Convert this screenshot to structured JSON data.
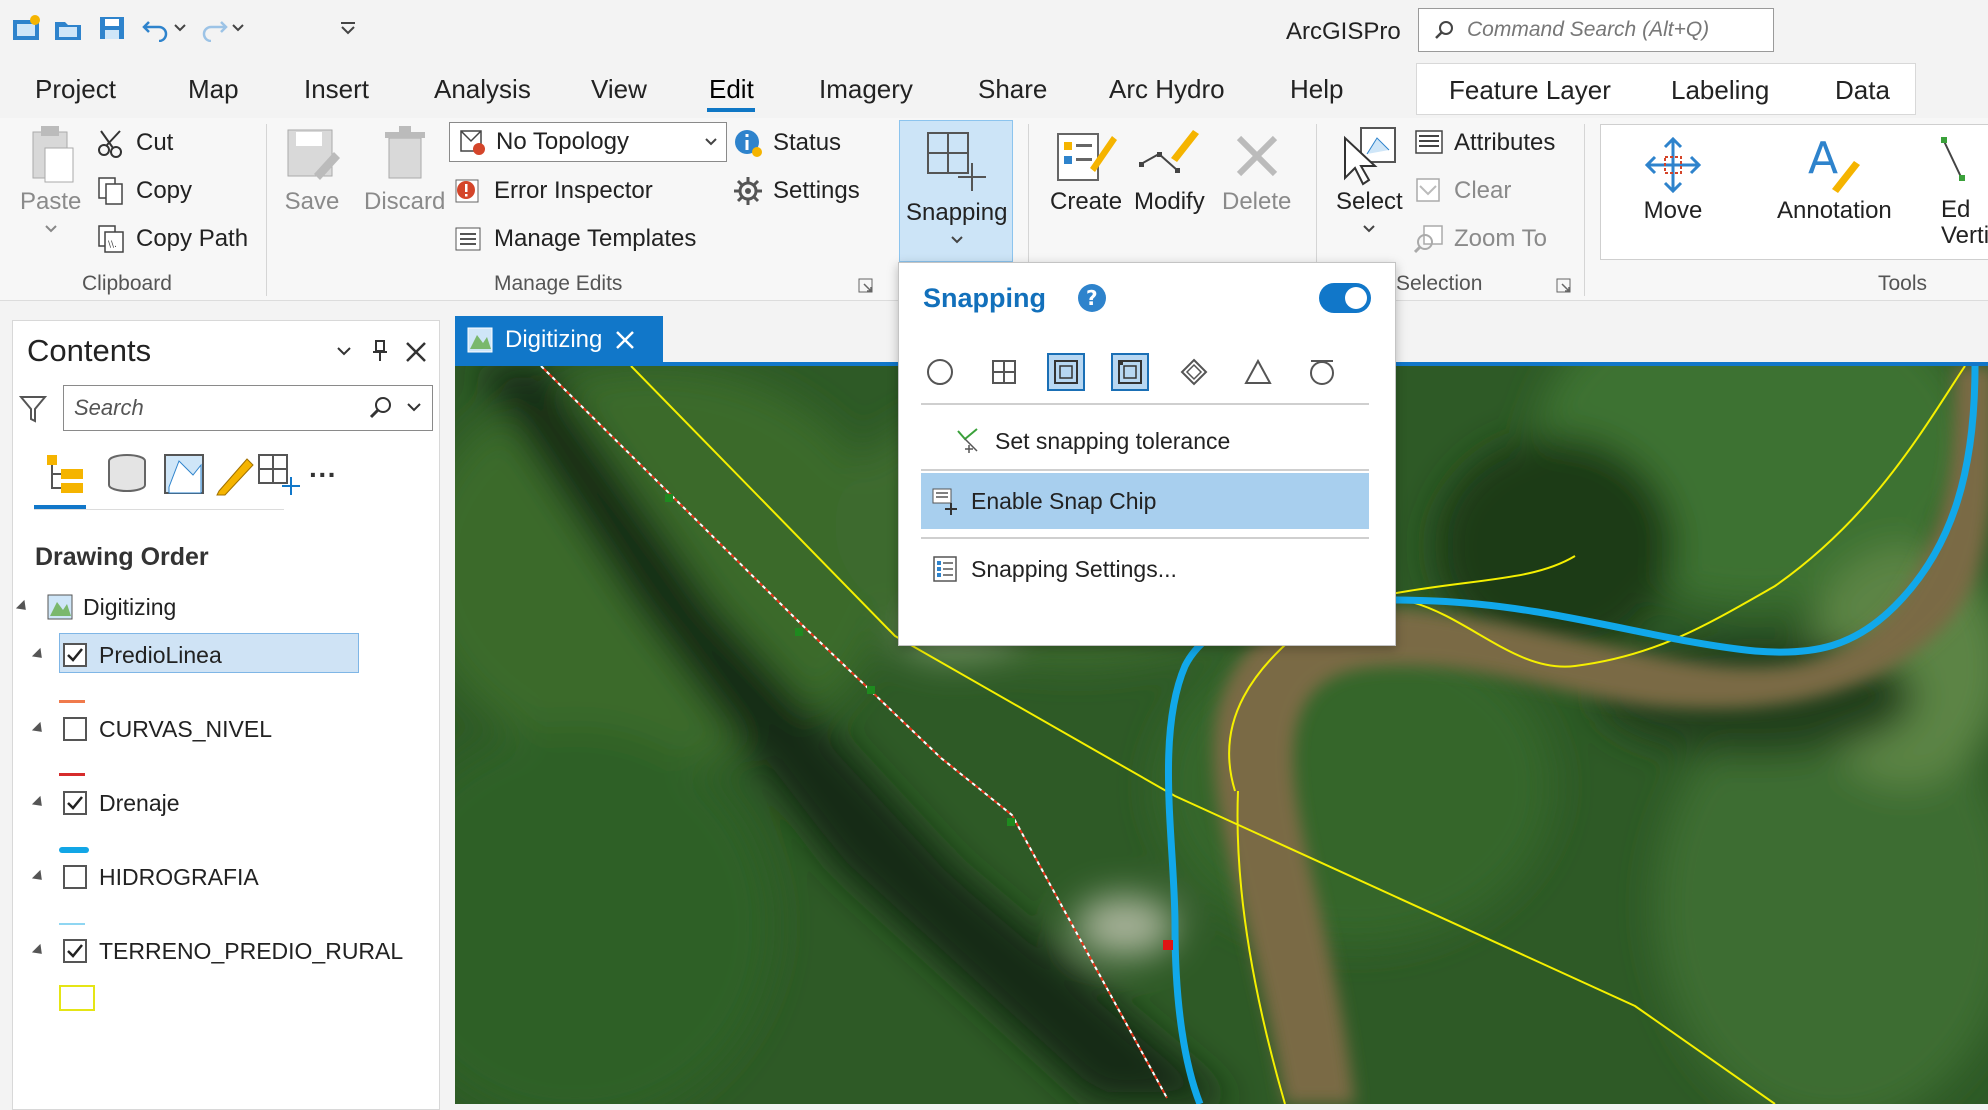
{
  "app_title": "ArcGISPro",
  "command_search": {
    "placeholder": "Command Search (Alt+Q)"
  },
  "quick_access": [
    "new-project-icon",
    "open-project-icon",
    "save-project-icon",
    "undo-icon",
    "redo-icon",
    "customize-icon"
  ],
  "tabs": [
    {
      "label": "Project",
      "active": false
    },
    {
      "label": "Map",
      "active": false
    },
    {
      "label": "Insert",
      "active": false
    },
    {
      "label": "Analysis",
      "active": false
    },
    {
      "label": "View",
      "active": false
    },
    {
      "label": "Edit",
      "active": true
    },
    {
      "label": "Imagery",
      "active": false
    },
    {
      "label": "Share",
      "active": false
    },
    {
      "label": "Arc Hydro",
      "active": false
    },
    {
      "label": "Help",
      "active": false
    }
  ],
  "context_tabs": [
    {
      "label": "Feature Layer"
    },
    {
      "label": "Labeling"
    },
    {
      "label": "Data"
    }
  ],
  "ribbon": {
    "clipboard": {
      "group_label": "Clipboard",
      "paste": "Paste",
      "cut": "Cut",
      "copy": "Copy",
      "copy_path": "Copy Path"
    },
    "manage_edits": {
      "group_label": "Manage Edits",
      "save": "Save",
      "discard": "Discard",
      "topology_value": "No Topology",
      "error_inspector": "Error Inspector",
      "manage_templates": "Manage Templates",
      "status": "Status",
      "settings": "Settings"
    },
    "snapping": {
      "label": "Snapping"
    },
    "features": {
      "create": "Create",
      "modify": "Modify",
      "delete": "Delete"
    },
    "selection": {
      "group_label": "Selection",
      "select": "Select",
      "attributes": "Attributes",
      "clear": "Clear",
      "zoom_to": "Zoom To"
    },
    "tools": {
      "group_label": "Tools",
      "move": "Move",
      "annotation": "Annotation",
      "edit_vertices": "Ed\nVerti"
    }
  },
  "contents": {
    "title": "Contents",
    "search_placeholder": "Search",
    "drawing_order_label": "Drawing Order",
    "map_name": "Digitizing",
    "layers": [
      {
        "name": "PredioLinea",
        "checked": true,
        "selected": true,
        "symbol_color": "#f07a4c"
      },
      {
        "name": "CURVAS_NIVEL",
        "checked": false,
        "selected": false,
        "symbol_color": "#d62b2b"
      },
      {
        "name": "Drenaje",
        "checked": true,
        "selected": false,
        "symbol_color": "#12a6e6"
      },
      {
        "name": "HIDROGRAFIA",
        "checked": false,
        "selected": false,
        "symbol_color": "#8fd6f2"
      },
      {
        "name": "TERRENO_PREDIO_RURAL",
        "checked": true,
        "selected": false,
        "symbol_color": "#fdfd7a"
      }
    ]
  },
  "map_view": {
    "tab_label": "Digitizing"
  },
  "snapping_menu": {
    "title": "Snapping",
    "enabled": true,
    "snap_types": [
      {
        "name": "point-snap-icon",
        "active": false
      },
      {
        "name": "vertex-snap-icon",
        "active": false
      },
      {
        "name": "edge-snap-icon",
        "active": true
      },
      {
        "name": "end-snap-icon",
        "active": true
      },
      {
        "name": "intersection-snap-icon",
        "active": false
      },
      {
        "name": "midpoint-snap-icon",
        "active": false
      },
      {
        "name": "tangent-snap-icon",
        "active": false
      }
    ],
    "items": [
      {
        "label": "Set snapping tolerance",
        "highlighted": false
      },
      {
        "label": "Enable Snap Chip",
        "highlighted": true
      },
      {
        "label": "Snapping Settings...",
        "highlighted": false
      }
    ]
  },
  "colors": {
    "accent": "#1177c9",
    "selected_row": "#cfe3f5",
    "menu_highlight": "#a8cfee"
  }
}
